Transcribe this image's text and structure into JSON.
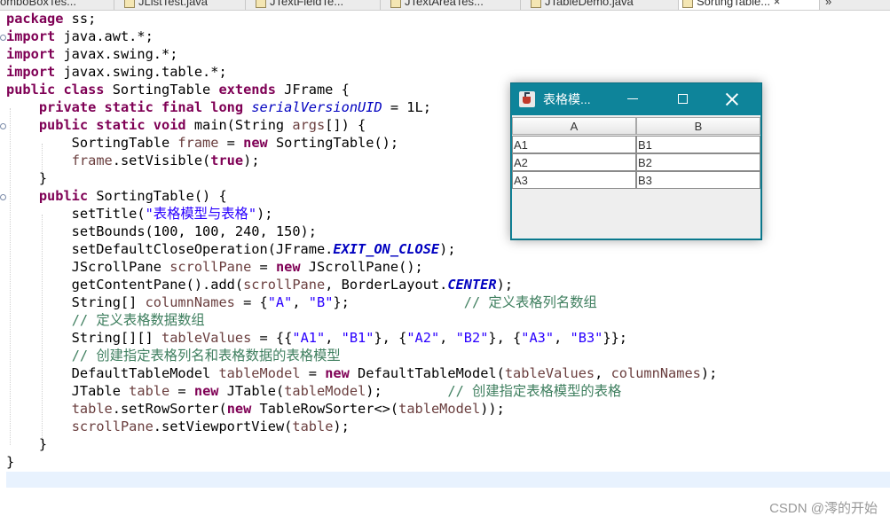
{
  "editor_tabs": [
    {
      "label": "omboBoxTes..."
    },
    {
      "label": "JListTest.java"
    },
    {
      "label": "JTextFieldTe..."
    },
    {
      "label": "JTextAreaTes..."
    },
    {
      "label": "JTableDemo.java"
    },
    {
      "label": "SortingTable..."
    }
  ],
  "tab_close": "×",
  "tab_overflow": "»",
  "code": {
    "l1": [
      "package",
      " ss;"
    ],
    "l2": [
      "import",
      " java.awt.*;"
    ],
    "l3": [
      "import",
      " javax.swing.*;"
    ],
    "l4": [
      "import",
      " javax.swing.table.*;"
    ],
    "l5": [
      "public class",
      " SortingTable ",
      "extends",
      " JFrame {"
    ],
    "l6": [
      "    ",
      "private static final long",
      " ",
      "serialVersionUID",
      " = 1L;"
    ],
    "l7": [
      "    ",
      "public static void",
      " main(String ",
      "args",
      "[]) {"
    ],
    "l8": [
      "        SortingTable ",
      "frame",
      " = ",
      "new",
      " SortingTable();"
    ],
    "l9": [
      "        ",
      "frame",
      ".setVisible(",
      "true",
      ");"
    ],
    "l10": [
      "    }"
    ],
    "l11": [
      "    ",
      "public",
      " SortingTable() {"
    ],
    "l12": [
      "        setTitle(",
      "\"表格模型与表格\"",
      ");"
    ],
    "l13": [
      "        setBounds(100, 100, 240, 150);"
    ],
    "l14": [
      "        setDefaultCloseOperation(JFrame.",
      "EXIT_ON_CLOSE",
      ");"
    ],
    "l15": [
      "        JScrollPane ",
      "scrollPane",
      " = ",
      "new",
      " JScrollPane();"
    ],
    "l16": [
      "        getContentPane().add(",
      "scrollPane",
      ", BorderLayout.",
      "CENTER",
      ");"
    ],
    "l17": [
      "        String[] ",
      "columnNames",
      " = {",
      "\"A\"",
      ", ",
      "\"B\"",
      "};              ",
      "// 定义表格列名数组"
    ],
    "l18": [
      "        ",
      "// 定义表格数据数组"
    ],
    "l19": [
      "        String[][] ",
      "tableValues",
      " = {{",
      "\"A1\"",
      ", ",
      "\"B1\"",
      "}, {",
      "\"A2\"",
      ", ",
      "\"B2\"",
      "}, {",
      "\"A3\"",
      ", ",
      "\"B3\"",
      "}};"
    ],
    "l20": [
      "        ",
      "// 创建指定表格列名和表格数据的表格模型"
    ],
    "l21": [
      "        DefaultTableModel ",
      "tableModel",
      " = ",
      "new",
      " DefaultTableModel(",
      "tableValues",
      ", ",
      "columnNames",
      ");"
    ],
    "l22": [
      "        JTable ",
      "table",
      " = ",
      "new",
      " JTable(",
      "tableModel",
      ");        ",
      "// 创建指定表格模型的表格"
    ],
    "l23": [
      "        ",
      "table",
      ".setRowSorter(",
      "new",
      " TableRowSorter<>(",
      "tableModel",
      "));"
    ],
    "l24": [
      "        ",
      "scrollPane",
      ".setViewportView(",
      "table",
      ");"
    ],
    "l25": [
      "    }"
    ],
    "l26": [
      "}"
    ]
  },
  "app_window": {
    "title": "表格模...",
    "columns": [
      "A",
      "B"
    ],
    "rows": [
      [
        "A1",
        "B1"
      ],
      [
        "A2",
        "B2"
      ],
      [
        "A3",
        "B3"
      ]
    ]
  },
  "watermark": "CSDN @澪的开始",
  "colors": {
    "keyword": "#7f0055",
    "string": "#2a00ff",
    "field": "#0000c0",
    "local_var": "#6a3e3e",
    "comment": "#3f7f5f",
    "window_frame": "#0e849a"
  },
  "icons": {
    "window_icon": "java-app-icon",
    "minimize": "minimize-icon",
    "maximize": "maximize-icon",
    "close": "close-icon"
  }
}
